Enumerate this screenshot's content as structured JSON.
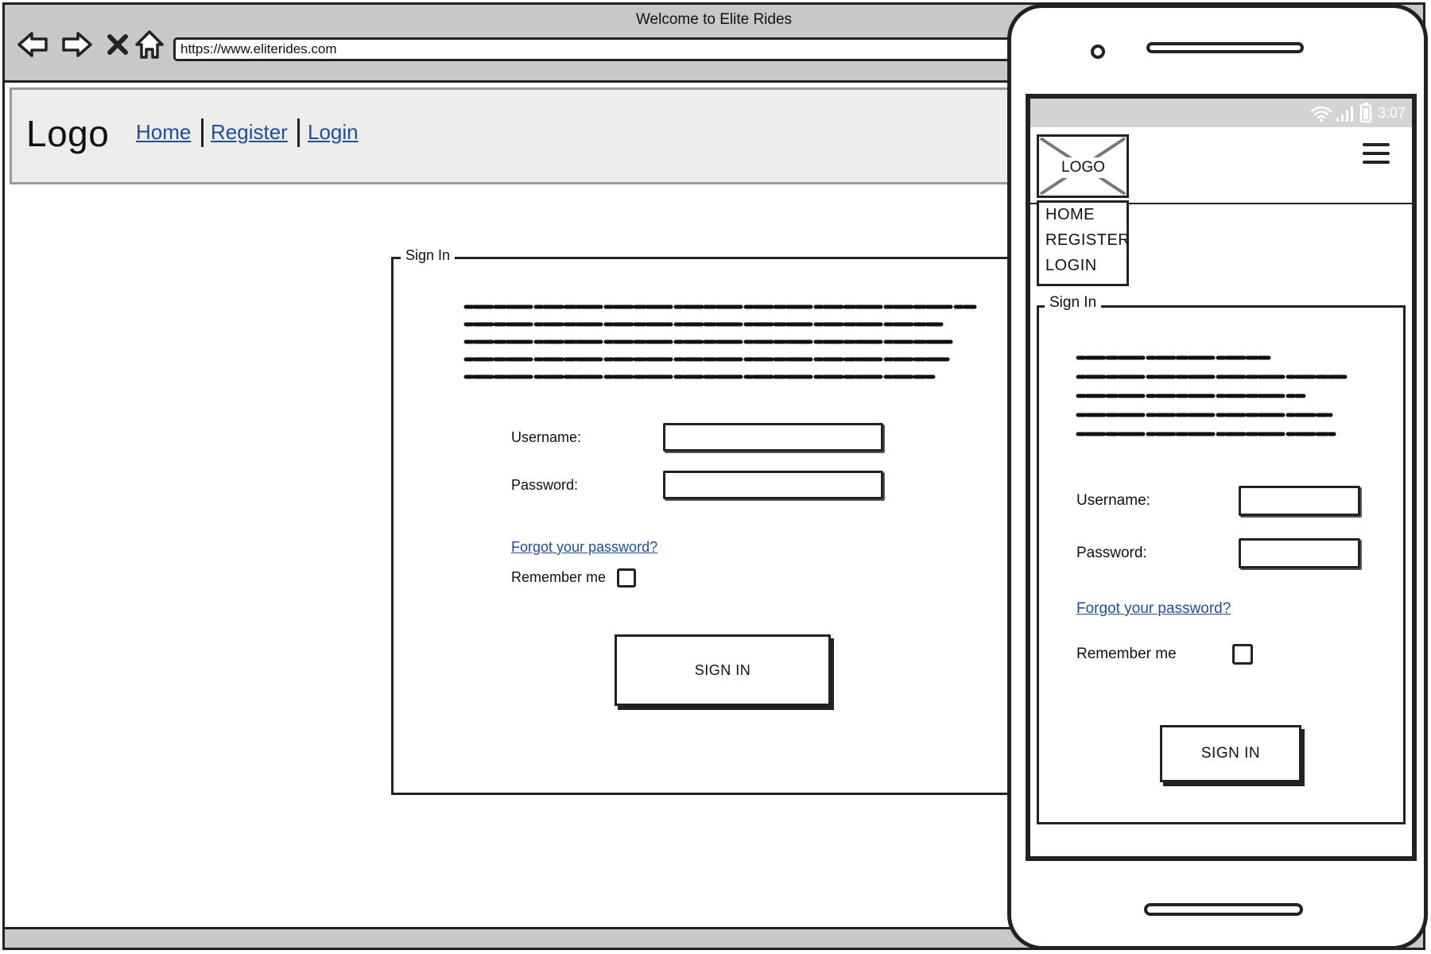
{
  "browser": {
    "window_title": "Welcome to Elite Rides",
    "url": "https://www.eliterides.com"
  },
  "site": {
    "logo": "Logo",
    "nav": [
      "Home",
      "Register",
      "Login"
    ]
  },
  "signin": {
    "legend": "Sign In",
    "username_label": "Username:",
    "password_label": "Password:",
    "forgot_link": "Forgot your password?",
    "remember_label": "Remember me",
    "button_label": "SIGN IN"
  },
  "mobile": {
    "time": "3:07",
    "logo": "LOGO",
    "menu": [
      "HOME",
      "REGISTER",
      "LOGIN"
    ],
    "legend": "Sign In",
    "username_label": "Username:",
    "password_label": "Password:",
    "forgot_link": "Forgot your password?",
    "remember_label": "Remember me",
    "button_label": "SIGN IN"
  },
  "colors": {
    "link": "#1f4f9c",
    "chrome": "#c8c8c8",
    "header_bg": "#ececec"
  },
  "icons": [
    "back-arrow-icon",
    "forward-arrow-icon",
    "close-icon",
    "home-icon",
    "wifi-icon",
    "signal-icon",
    "battery-icon",
    "hamburger-menu-icon"
  ]
}
